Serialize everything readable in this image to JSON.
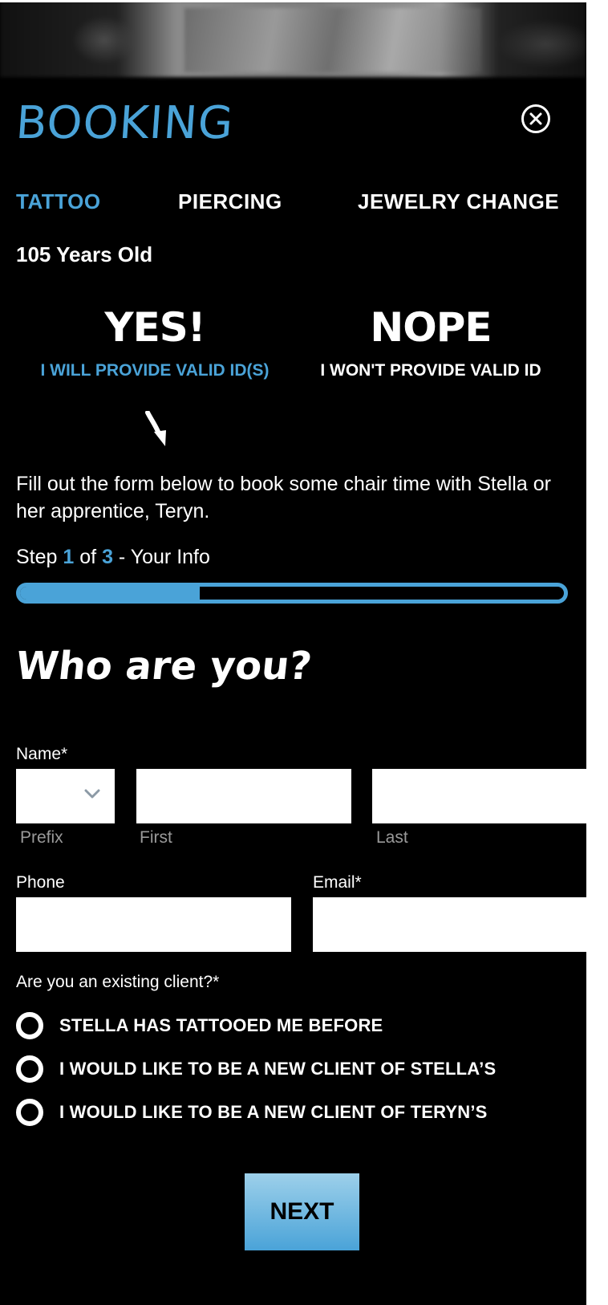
{
  "modal": {
    "title": "BOOKING",
    "close_icon": "close-circle-icon"
  },
  "tabs": [
    {
      "label": "TATTOO",
      "active": true
    },
    {
      "label": "PIERCING",
      "active": false
    },
    {
      "label": "JEWELRY CHANGE",
      "active": false
    }
  ],
  "age_text": "105 Years Old",
  "id_choice": {
    "yes": {
      "title": "YES!",
      "subtitle": "I WILL PROVIDE VALID ID(S)",
      "selected": true
    },
    "no": {
      "title": "NOPE",
      "subtitle": "I WON'T PROVIDE VALID ID",
      "selected": false
    },
    "arrow_icon": "arrow-down-icon"
  },
  "intro_text": "Fill out the form below to book some chair time with Stella or her apprentice, Teryn.",
  "step": {
    "prefix": "Step",
    "current": "1",
    "of": "of",
    "total": "3",
    "suffix": "- Your Info",
    "progress_fraction": 0.33
  },
  "form": {
    "heading": "Who are you?",
    "name_label": "Name*",
    "prefix_sublabel": "Prefix",
    "first_sublabel": "First",
    "last_sublabel": "Last",
    "prefix_value": "",
    "first_value": "",
    "last_value": "",
    "phone_label": "Phone",
    "email_label": "Email*",
    "phone_value": "",
    "email_value": "",
    "existing_question": "Are you an existing client?*",
    "options": [
      "STELLA HAS TATTOOED ME BEFORE",
      "I WOULD LIKE TO BE A NEW CLIENT OF STELLA’S",
      "I WOULD LIKE TO BE A NEW CLIENT OF TERYN’S"
    ],
    "next_label": "NEXT"
  },
  "colors": {
    "accent": "#4aa3d8",
    "background": "#000000",
    "text": "#ffffff"
  }
}
